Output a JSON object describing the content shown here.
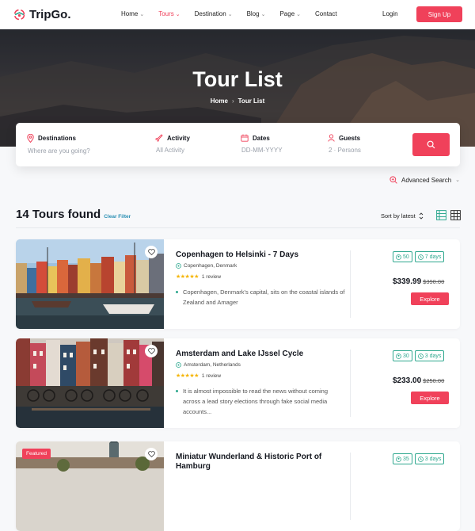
{
  "brand": {
    "name": "TripGo."
  },
  "nav": {
    "items": [
      {
        "label": "Home",
        "dropdown": true,
        "active": false
      },
      {
        "label": "Tours",
        "dropdown": true,
        "active": true
      },
      {
        "label": "Destination",
        "dropdown": true,
        "active": false
      },
      {
        "label": "Blog",
        "dropdown": true,
        "active": false
      },
      {
        "label": "Page",
        "dropdown": true,
        "active": false
      },
      {
        "label": "Contact",
        "dropdown": false,
        "active": false
      }
    ],
    "login": "Login",
    "signup": "Sign Up"
  },
  "hero": {
    "title": "Tour List",
    "breadcrumb": [
      "Home",
      "Tour List"
    ]
  },
  "search": {
    "fields": [
      {
        "label": "Destinations",
        "placeholder": "Where are you going?",
        "icon": "map-pin-icon"
      },
      {
        "label": "Activity",
        "placeholder": "All Activity",
        "icon": "plane-icon"
      },
      {
        "label": "Dates",
        "placeholder": "DD-MM-YYYY",
        "icon": "calendar-icon"
      },
      {
        "label": "Guests",
        "placeholder": "2 · Persons",
        "icon": "user-icon"
      }
    ],
    "button_icon": "search-icon",
    "advanced": "Advanced Search"
  },
  "results": {
    "count_text": "14 Tours found",
    "clear": "Clear Filter",
    "sort": "Sort by latest"
  },
  "tours": [
    {
      "title": "Copenhagen to Helsinki - 7 Days",
      "location": "Copenhagen, Denmark",
      "rating": 5,
      "reviews": "1 review",
      "description": "Copenhagen, Denmark's capital, sits on the coastal islands of Zealand and Amager",
      "people": "50",
      "duration": "7 days",
      "price": "$339.99",
      "old_price": "$390.00",
      "button": "Explore",
      "featured": ""
    },
    {
      "title": "Amsterdam and Lake IJssel Cycle",
      "location": "Amsterdam, Netherlands",
      "rating": 5,
      "reviews": "1 review",
      "description": "It is almost impossible to read the news without coming across a lead story elections through fake social media accounts...",
      "people": "30",
      "duration": "3 days",
      "price": "$233.00",
      "old_price": "$250.00",
      "button": "Explore",
      "featured": ""
    },
    {
      "title": "Miniatur Wunderland & Historic Port of Hamburg",
      "location": "",
      "rating": 0,
      "reviews": "",
      "description": "",
      "people": "35",
      "duration": "3 days",
      "price": "",
      "old_price": "",
      "button": "",
      "featured": "Featured"
    }
  ],
  "colors": {
    "accent": "#f0415a",
    "teal": "#2fa88f",
    "link": "#2a8fb3"
  }
}
